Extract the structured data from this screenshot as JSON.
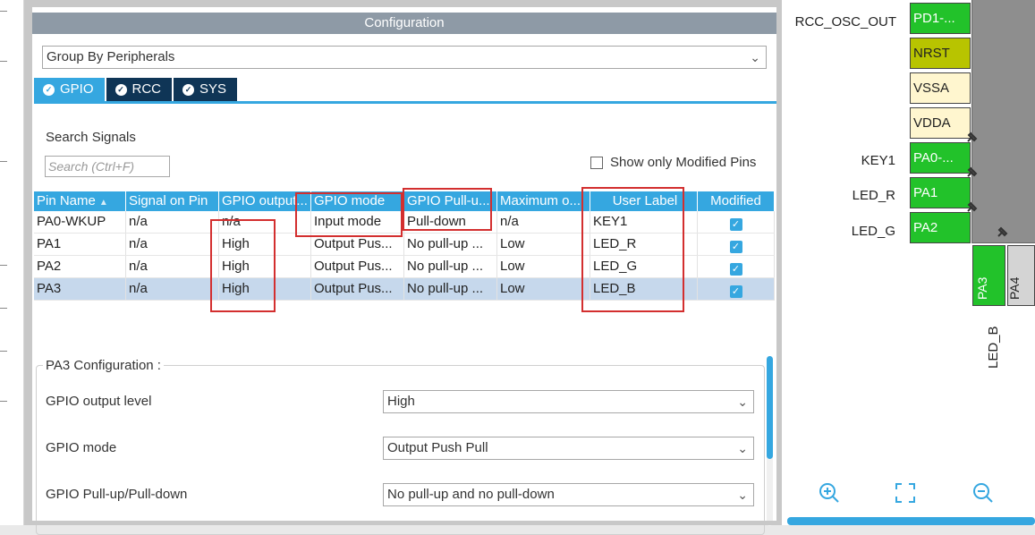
{
  "config": {
    "header": "Configuration",
    "group_by": "Group By Peripherals",
    "tabs": [
      {
        "label": "GPIO",
        "active": true
      },
      {
        "label": "RCC",
        "active": false
      },
      {
        "label": "SYS",
        "active": false
      }
    ],
    "search_label": "Search Signals",
    "search_placeholder": "Search (Ctrl+F)",
    "show_modified_label": "Show only Modified Pins"
  },
  "table": {
    "columns": [
      "Pin Name",
      "Signal on Pin",
      "GPIO output...",
      "GPIO mode",
      "GPIO Pull-u...",
      "Maximum o...",
      "User Label",
      "Modified"
    ],
    "rows": [
      {
        "pin": "PA0-WKUP",
        "signal": "n/a",
        "output": "n/a",
        "mode": "Input mode",
        "pull": "Pull-down",
        "speed": "n/a",
        "label": "KEY1",
        "modified": true,
        "selected": false
      },
      {
        "pin": "PA1",
        "signal": "n/a",
        "output": "High",
        "mode": "Output Pus...",
        "pull": "No pull-up ...",
        "speed": "Low",
        "label": "LED_R",
        "modified": true,
        "selected": false
      },
      {
        "pin": "PA2",
        "signal": "n/a",
        "output": "High",
        "mode": "Output Pus...",
        "pull": "No pull-up ...",
        "speed": "Low",
        "label": "LED_G",
        "modified": true,
        "selected": false
      },
      {
        "pin": "PA3",
        "signal": "n/a",
        "output": "High",
        "mode": "Output Pus...",
        "pull": "No pull-up ...",
        "speed": "Low",
        "label": "LED_B",
        "modified": true,
        "selected": true
      }
    ]
  },
  "pin_config": {
    "legend": "PA3 Configuration :",
    "fields": [
      {
        "label": "GPIO output level",
        "value": "High"
      },
      {
        "label": "GPIO mode",
        "value": "Output Push Pull"
      },
      {
        "label": "GPIO Pull-up/Pull-down",
        "value": "No pull-up and no pull-down"
      }
    ]
  },
  "chip": {
    "pins": [
      {
        "name": "PD1-...",
        "label": "RCC_OSC_OUT",
        "color": "green"
      },
      {
        "name": "NRST",
        "label": "",
        "color": "olive"
      },
      {
        "name": "VSSA",
        "label": "",
        "color": "cream"
      },
      {
        "name": "VDDA",
        "label": "",
        "color": "cream"
      },
      {
        "name": "PA0-...",
        "label": "KEY1",
        "color": "green"
      },
      {
        "name": "PA1",
        "label": "LED_R",
        "color": "green"
      },
      {
        "name": "PA2",
        "label": "LED_G",
        "color": "green"
      }
    ],
    "bottom_pins": [
      {
        "name": "PA3",
        "color": "green"
      },
      {
        "name": "PA4",
        "color": "gray"
      }
    ],
    "bottom_label": "LED_B",
    "colors": {
      "green": "#22c22a",
      "olive": "#b8c400",
      "cream": "#fff6cf",
      "accent": "#35a7e0",
      "highlight": "#d32f2f"
    }
  }
}
